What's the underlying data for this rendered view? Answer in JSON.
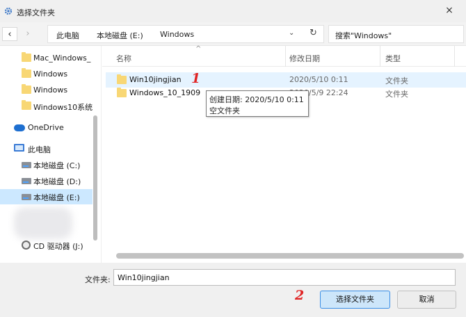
{
  "window": {
    "title": "选择文件夹",
    "close_glyph": "×"
  },
  "address": {
    "breadcrumbs": [
      "此电脑",
      "本地磁盘 (E:)",
      "Windows"
    ],
    "dropdown_glyph": "⌄",
    "refresh_glyph": "↻"
  },
  "search": {
    "placeholder": "搜索\"Windows\""
  },
  "nav": {
    "back": "‹",
    "forward": "›"
  },
  "sidebar": {
    "items": [
      {
        "label": "Mac_Windows_",
        "icon": "folder-icon"
      },
      {
        "label": "Windows",
        "icon": "folder-icon"
      },
      {
        "label": "Windows",
        "icon": "folder-icon"
      },
      {
        "label": "Windows10系统",
        "icon": "folder-icon"
      },
      {
        "label": "OneDrive",
        "icon": "cloud-icon"
      },
      {
        "label": "此电脑",
        "icon": "computer-icon"
      },
      {
        "label": "本地磁盘 (C:)",
        "icon": "drive-icon"
      },
      {
        "label": "本地磁盘 (D:)",
        "icon": "drive-icon"
      },
      {
        "label": "本地磁盘 (E:)",
        "icon": "drive-icon",
        "selected": true
      },
      {
        "label": "CD 驱动器 (J:)",
        "icon": "cd-drive-icon"
      }
    ]
  },
  "columns": {
    "name": "名称",
    "date": "修改日期",
    "type": "类型"
  },
  "files": [
    {
      "name": "Win10jingjian",
      "date": "2020/5/10 0:11",
      "type": "文件夹"
    },
    {
      "name": "Windows_10_1909",
      "date": "2020/5/9 22:24",
      "type": "文件夹"
    }
  ],
  "tooltip": {
    "line1": "创建日期: 2020/5/10 0:11",
    "line2": "空文件夹"
  },
  "annotations": {
    "first": "1",
    "second": "2"
  },
  "footer": {
    "folder_label": "文件夹:",
    "folder_value": "Win10jingjian",
    "select_button": "选择文件夹",
    "cancel_button": "取消"
  },
  "colors": {
    "accent": "#3a8ee6",
    "selection": "#cce8ff",
    "annotation": "#e02424",
    "folder": "#f8d775"
  }
}
